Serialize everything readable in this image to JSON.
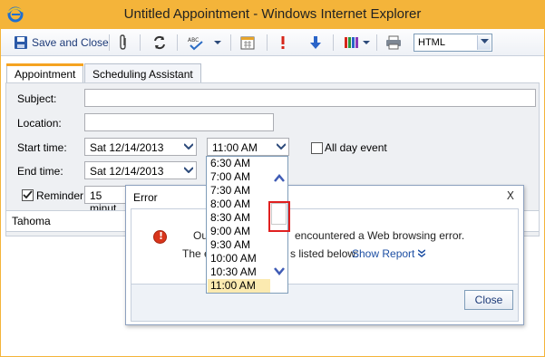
{
  "window": {
    "title": "Untitled Appointment - Windows Internet Explorer"
  },
  "toolbar": {
    "save_close_label": "Save and Close",
    "format_value": "HTML",
    "icons": [
      "save-icon",
      "attach-icon",
      "recurrence-icon",
      "spellcheck-icon",
      "calendar-icon",
      "importance-high-icon",
      "importance-low-icon",
      "categorize-icon",
      "print-icon"
    ]
  },
  "tabs": [
    {
      "label": "Appointment",
      "active": true
    },
    {
      "label": "Scheduling Assistant",
      "active": false
    }
  ],
  "form": {
    "subject_label": "Subject:",
    "location_label": "Location:",
    "start_label": "Start time:",
    "start_date": "Sat 12/14/2013",
    "start_time": "11:00 AM",
    "all_day_label": "All day event",
    "end_label": "End time:",
    "end_date": "Sat 12/14/2013",
    "reminder_label": "Reminder:",
    "reminder_value": "15 minut",
    "font_name": "Tahoma"
  },
  "time_dropdown": {
    "options": [
      "6:30 AM",
      "7:00 AM",
      "7:30 AM",
      "8:00 AM",
      "8:30 AM",
      "9:00 AM",
      "9:30 AM",
      "10:00 AM",
      "10:30 AM",
      "11:00 AM"
    ],
    "selected": "11:00 AM"
  },
  "dialog": {
    "title": "Error",
    "close_glyph": "X",
    "msg1_left": "Outlo",
    "msg1_right": "encountered a Web browsing error.",
    "msg2_left": "The e",
    "msg2_right": "s listed below:",
    "show_report": "Show Report",
    "close_button": "Close"
  },
  "colors": {
    "title_bar": "#f4b43a",
    "accent_tab": "#f5a321",
    "highlight": "#e02020",
    "link": "#1d4fa3"
  }
}
